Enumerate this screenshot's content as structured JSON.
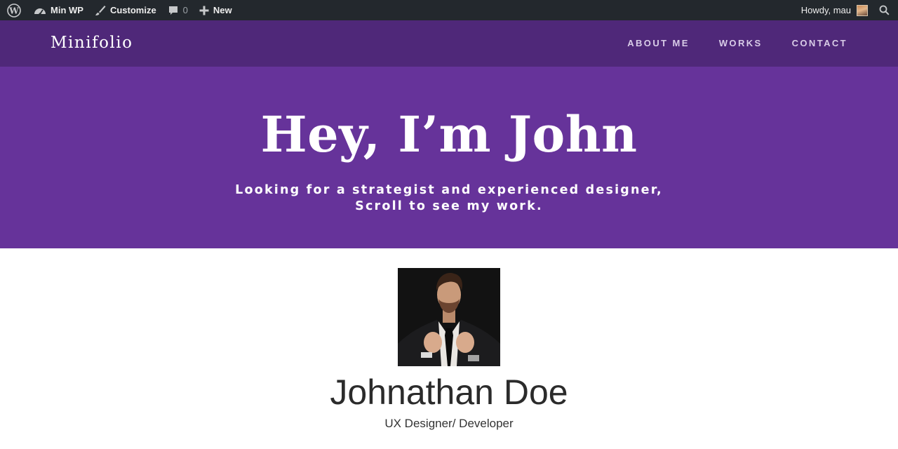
{
  "adminbar": {
    "site_name": "Min WP",
    "customize_label": "Customize",
    "comments_count": "0",
    "new_label": "New",
    "howdy_text": "Howdy, mau",
    "icons": {
      "wp": "wordpress-logo-icon",
      "site": "dashboard-icon",
      "customize": "paintbrush-icon",
      "comments": "comment-bubble-icon",
      "new": "plus-icon",
      "search": "search-icon"
    }
  },
  "header": {
    "brand": "Minifolio",
    "nav": [
      "ABOUT ME",
      "WORKS",
      "CONTACT"
    ]
  },
  "hero": {
    "title": "Hey, I’m John",
    "subtitle_line1": "Looking for a strategist and experienced designer,",
    "subtitle_line2": "Scroll to see my work."
  },
  "profile": {
    "name": "Johnathan Doe",
    "role": "UX Designer/ Developer"
  },
  "colors": {
    "adminbar_bg": "#23282d",
    "header_bg": "#4f2879",
    "hero_bg": "#66339a",
    "page_bg": "#ffffff"
  }
}
